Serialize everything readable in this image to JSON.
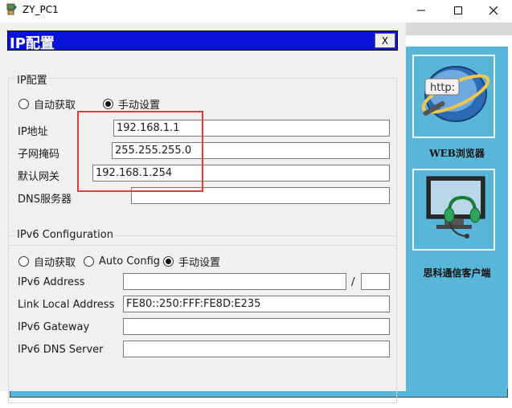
{
  "window": {
    "title": "ZY_PC1"
  },
  "dialog": {
    "title": "IP配置",
    "close_label": "X"
  },
  "ipv4": {
    "legend": "IP配置",
    "mode_dhcp": "自动获取",
    "mode_static": "手动设置",
    "selected_mode": "手动设置",
    "ip_label": "IP地址",
    "ip_value": "192.168.1.1",
    "mask_label": "子网掩码",
    "mask_value": "255.255.255.0",
    "gateway_label": "默认网关",
    "gateway_value": "192.168.1.254",
    "dns_label": "DNS服务器",
    "dns_value": ""
  },
  "ipv6": {
    "legend": "IPv6 Configuration",
    "mode_dhcp": "自动获取",
    "mode_auto": "Auto Config",
    "mode_static": "手动设置",
    "selected_mode": "手动设置",
    "address_label": "IPv6 Address",
    "address_value": "",
    "prefix_sep": "/",
    "prefix_value": "",
    "link_local_label": "Link Local Address",
    "link_local_value": "FE80::250:FFF:FE8D:E235",
    "gateway_label": "IPv6 Gateway",
    "gateway_value": "",
    "dns_label": "IPv6 DNS Server",
    "dns_value": ""
  },
  "desktop": {
    "web_browser_label": "WEB浏览器",
    "web_icon_text": "http:",
    "cisco_client_label": "思科通信客户端"
  },
  "colors": {
    "dialog_header": "#0a14d8",
    "desktop_bg": "#5ab6d8",
    "highlight_box": "#e03a3a"
  }
}
